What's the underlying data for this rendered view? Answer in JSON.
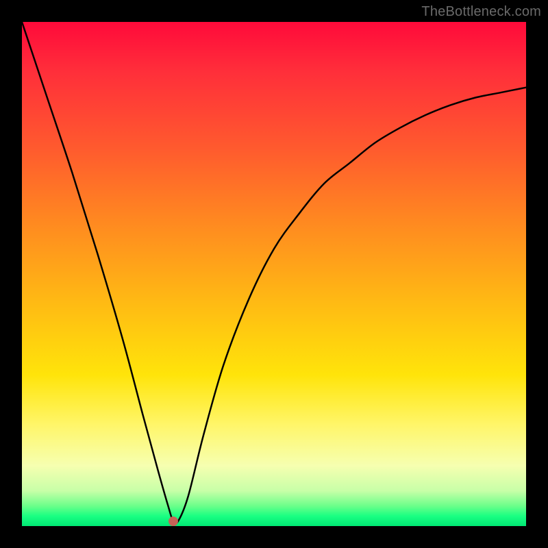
{
  "attribution": "TheBottleneck.com",
  "colors": {
    "frame": "#000000",
    "gradient_top": "#ff0a3a",
    "gradient_bottom": "#00e874",
    "curve": "#000000",
    "min_marker": "#c56257"
  },
  "chart_data": {
    "type": "line",
    "title": "",
    "xlabel": "",
    "ylabel": "",
    "xlim": [
      0,
      100
    ],
    "ylim": [
      0,
      100
    ],
    "min_marker": {
      "x": 30,
      "y": 1
    },
    "series": [
      {
        "name": "curve",
        "x": [
          0,
          5,
          10,
          15,
          20,
          24,
          27,
          29,
          30,
          31,
          33,
          36,
          40,
          45,
          50,
          55,
          60,
          65,
          70,
          75,
          80,
          85,
          90,
          95,
          100
        ],
        "values": [
          100,
          85,
          70,
          54,
          37,
          22,
          11,
          4,
          1,
          1,
          6,
          18,
          32,
          45,
          55,
          62,
          68,
          72,
          76,
          79,
          81.5,
          83.5,
          85,
          86,
          87
        ]
      }
    ]
  }
}
